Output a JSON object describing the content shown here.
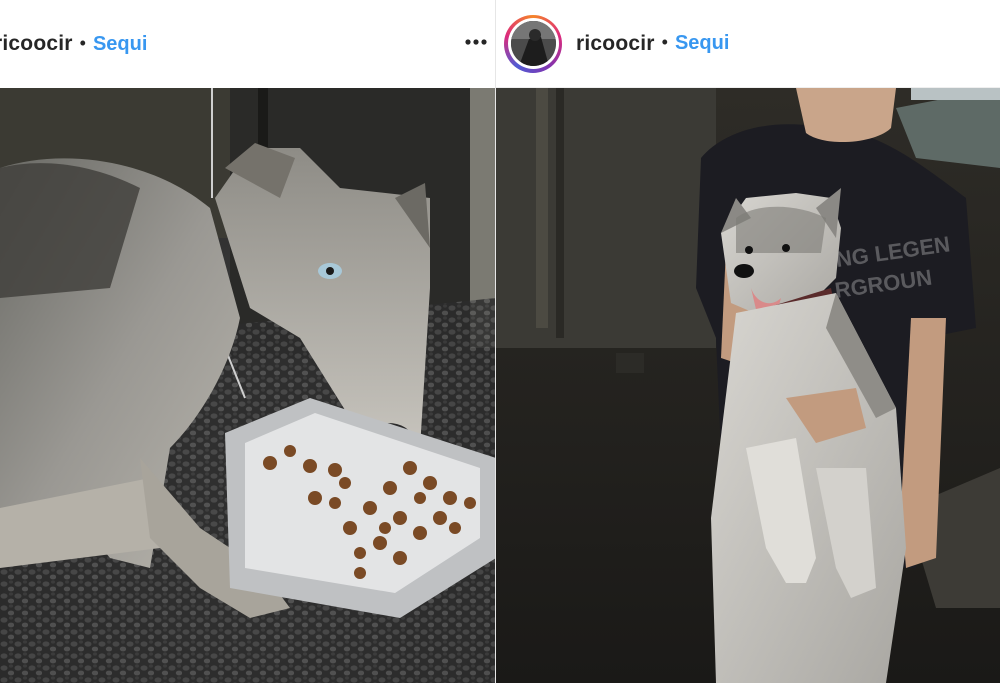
{
  "posts": [
    {
      "username": "ricoocir",
      "separator": "•",
      "follow_label": "Sequi",
      "more_icon": "more-horizontal-icon",
      "photo_subject": "thin-dog-eating-kibble"
    },
    {
      "username": "ricoocir",
      "separator": "•",
      "follow_label": "Sequi",
      "photo_subject": "person-holding-husky"
    }
  ],
  "colors": {
    "follow_link": "#3897f0",
    "username_text": "#262626",
    "ring_gradient": [
      "#f58529",
      "#dd2a7b",
      "#8134af",
      "#515bd4"
    ]
  }
}
